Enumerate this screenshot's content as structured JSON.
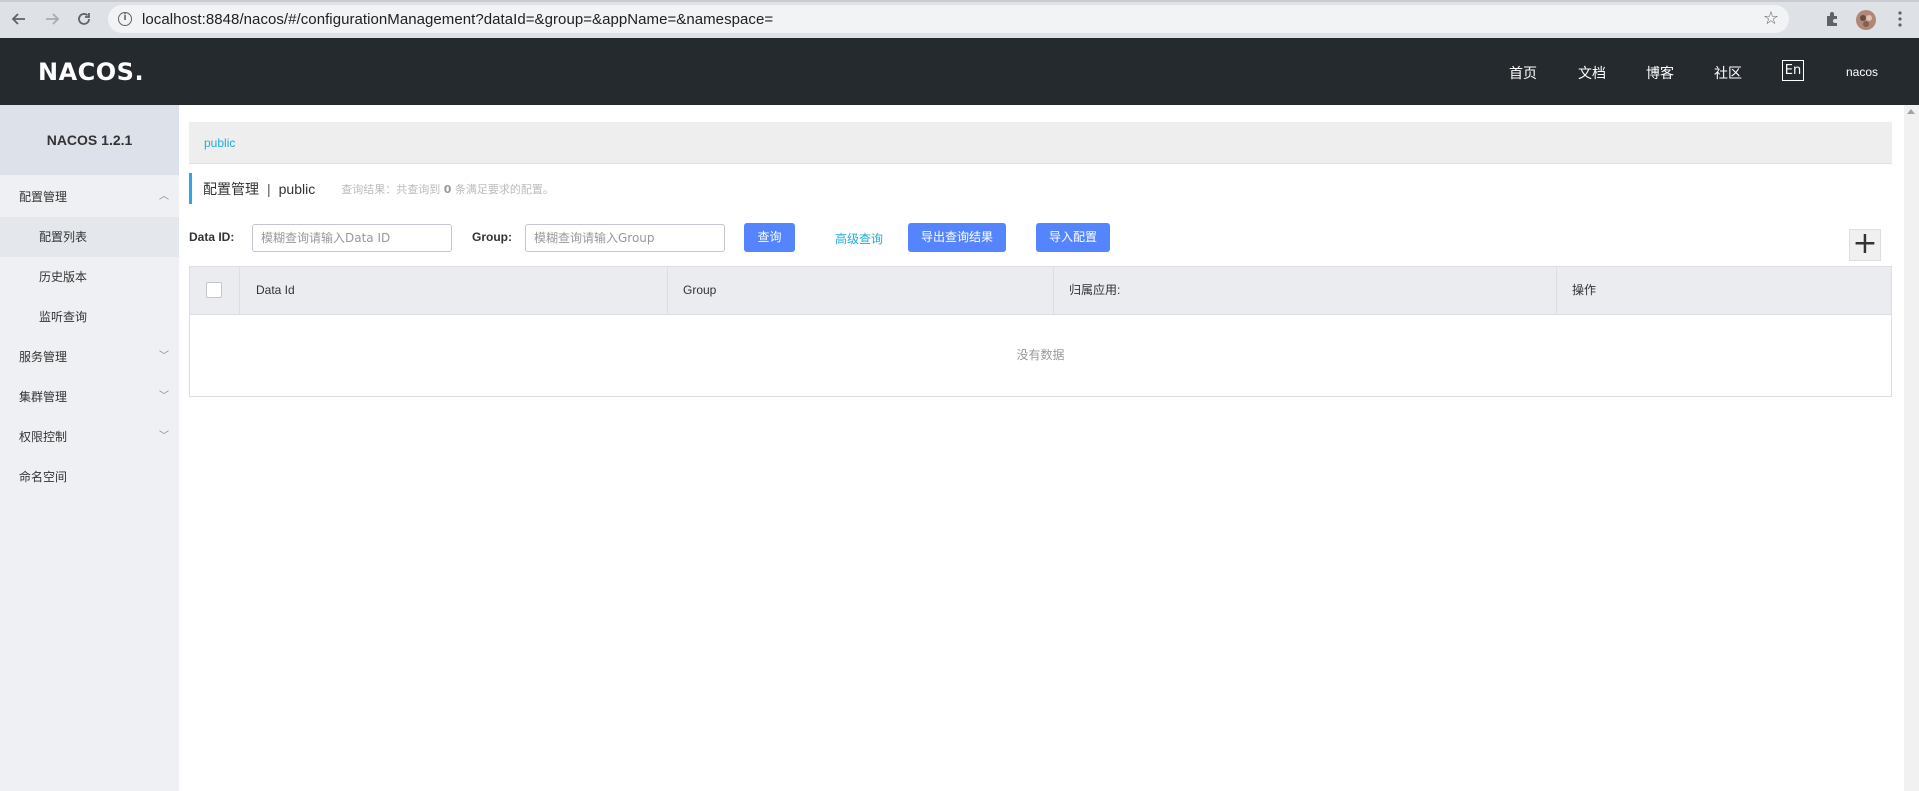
{
  "browser": {
    "url": "localhost:8848/nacos/#/configurationManagement?dataId=&group=&appName=&namespace="
  },
  "header": {
    "logo": "NACOS.",
    "nav": [
      "首页",
      "文档",
      "博客",
      "社区"
    ],
    "lang": "En",
    "user": "nacos"
  },
  "sidebar": {
    "title": "NACOS 1.2.1",
    "items": [
      {
        "label": "配置管理",
        "expanded": true
      },
      {
        "label": "配置列表",
        "sub": true,
        "active": true
      },
      {
        "label": "历史版本",
        "sub": true
      },
      {
        "label": "监听查询",
        "sub": true
      },
      {
        "label": "服务管理",
        "expanded": false
      },
      {
        "label": "集群管理",
        "expanded": false
      },
      {
        "label": "权限控制",
        "expanded": false
      },
      {
        "label": "命名空间"
      }
    ]
  },
  "breadcrumb": {
    "namespace": "public"
  },
  "page": {
    "title": "配置管理",
    "separator": "|",
    "namespace": "public",
    "result_prefix": "查询结果：共查询到",
    "result_count": "0",
    "result_suffix": "条满足要求的配置。"
  },
  "filters": {
    "dataid_label": "Data ID:",
    "dataid_placeholder": "模糊查询请输入Data ID",
    "group_label": "Group:",
    "group_placeholder": "模糊查询请输入Group",
    "query_button": "查询",
    "advanced_query": "高级查询",
    "export_button": "导出查询结果",
    "import_button": "导入配置",
    "add_button": "+"
  },
  "table": {
    "columns": [
      "Data Id",
      "Group",
      "归属应用:",
      "操作"
    ],
    "empty_text": "没有数据"
  },
  "colors": {
    "appbar": "#252a2f",
    "primary_button": "#5584ff",
    "link": "#1faeda",
    "sidebar": "#eef0f3"
  }
}
